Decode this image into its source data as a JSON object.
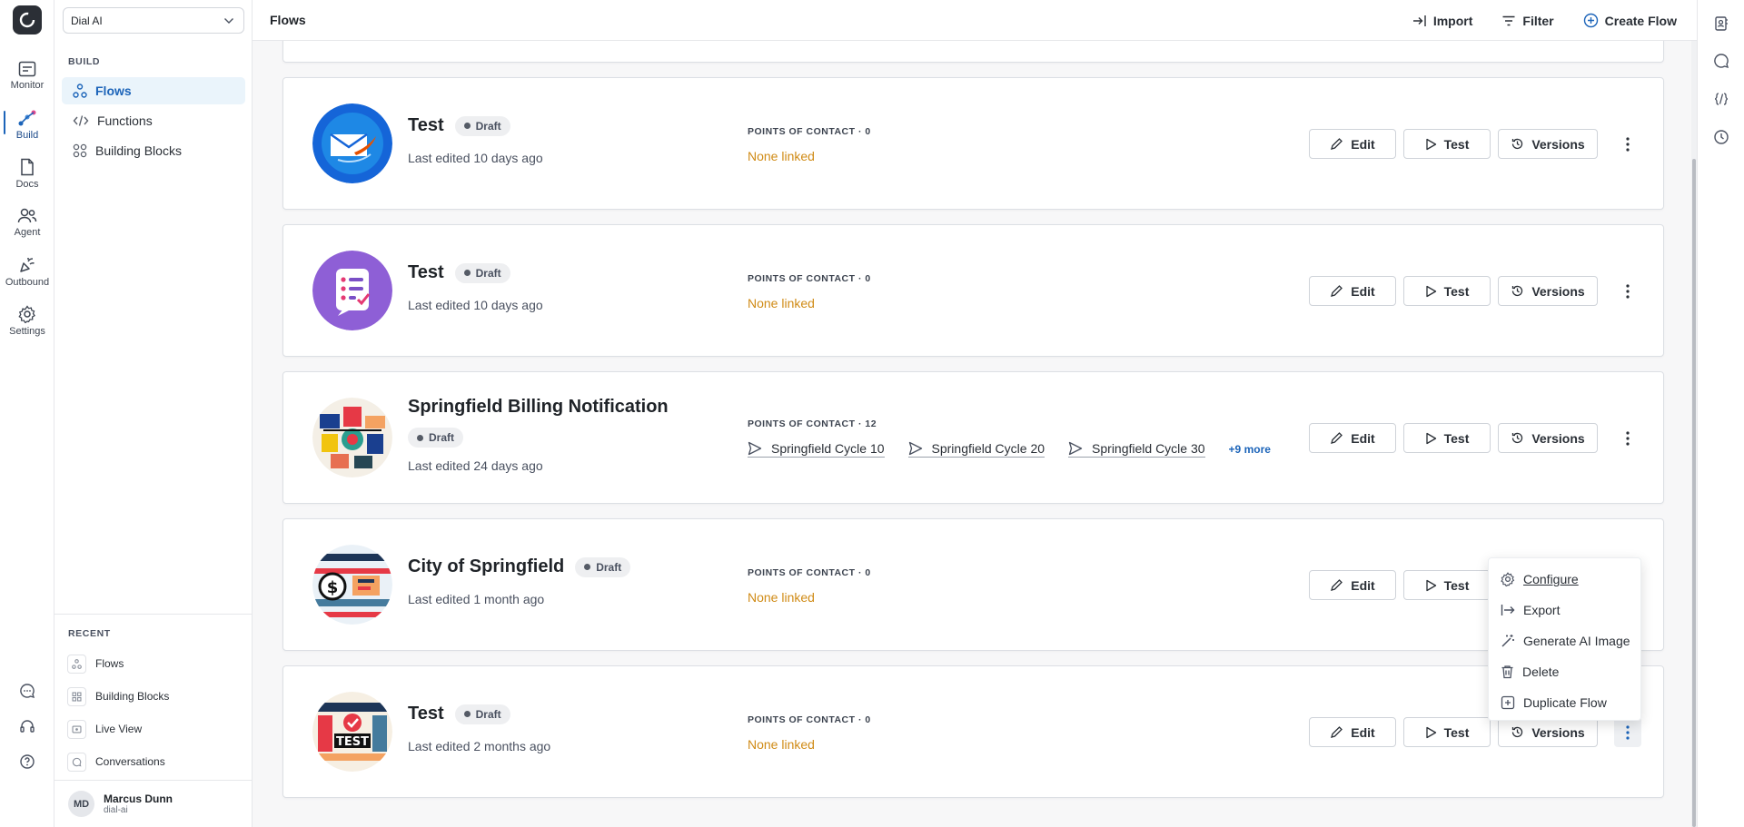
{
  "workspace": {
    "name": "Dial AI"
  },
  "rail": {
    "items": [
      {
        "label": "Monitor",
        "icon": "monitor-icon"
      },
      {
        "label": "Build",
        "icon": "build-icon"
      },
      {
        "label": "Docs",
        "icon": "docs-icon"
      },
      {
        "label": "Agent",
        "icon": "agent-icon"
      },
      {
        "label": "Outbound",
        "icon": "outbound-icon"
      },
      {
        "label": "Settings",
        "icon": "gear-icon"
      }
    ],
    "active": "Build"
  },
  "sidebar": {
    "section": "BUILD",
    "items": [
      {
        "label": "Flows",
        "icon": "flows-icon"
      },
      {
        "label": "Functions",
        "icon": "code-icon"
      },
      {
        "label": "Building Blocks",
        "icon": "blocks-icon"
      }
    ],
    "active": "Flows",
    "recent_title": "RECENT",
    "recent": [
      {
        "label": "Flows",
        "icon": "flows-icon"
      },
      {
        "label": "Building Blocks",
        "icon": "blocks-icon"
      },
      {
        "label": "Live View",
        "icon": "live-view-icon"
      },
      {
        "label": "Conversations",
        "icon": "chat-icon"
      }
    ]
  },
  "user": {
    "initials": "MD",
    "name": "Marcus Dunn",
    "org": "dial-ai"
  },
  "header": {
    "title": "Flows",
    "import_label": "Import",
    "filter_label": "Filter",
    "create_label": "Create Flow"
  },
  "flows": [
    {
      "title": "Test",
      "status": "Draft",
      "edited": "Last edited 10 days ago",
      "poc_label": "POINTS OF CONTACT · 0",
      "poc_none": "None linked"
    },
    {
      "title": "Test",
      "status": "Draft",
      "edited": "Last edited 10 days ago",
      "poc_label": "POINTS OF CONTACT · 0",
      "poc_none": "None linked"
    },
    {
      "title": "Springfield Billing Notification",
      "status": "Draft",
      "edited": "Last edited 24 days ago",
      "poc_label": "POINTS OF CONTACT · 12",
      "poc_links": [
        "Springfield Cycle 10",
        "Springfield Cycle 20",
        "Springfield Cycle 30"
      ],
      "poc_more": "+9 more"
    },
    {
      "title": "City of Springfield",
      "status": "Draft",
      "edited": "Last edited 1 month ago",
      "poc_label": "POINTS OF CONTACT · 0",
      "poc_none": "None linked"
    },
    {
      "title": "Test",
      "status": "Draft",
      "edited": "Last edited 2 months ago",
      "poc_label": "POINTS OF CONTACT · 0",
      "poc_none": "None linked"
    }
  ],
  "actions": {
    "edit": "Edit",
    "test": "Test",
    "versions": "Versions"
  },
  "menu": {
    "items": [
      "Configure",
      "Export",
      "Generate AI Image",
      "Delete",
      "Duplicate Flow"
    ]
  },
  "colors": {
    "accent": "#1c64b9",
    "warning_text": "#d08b16",
    "active_bg": "#eaf4fb"
  }
}
